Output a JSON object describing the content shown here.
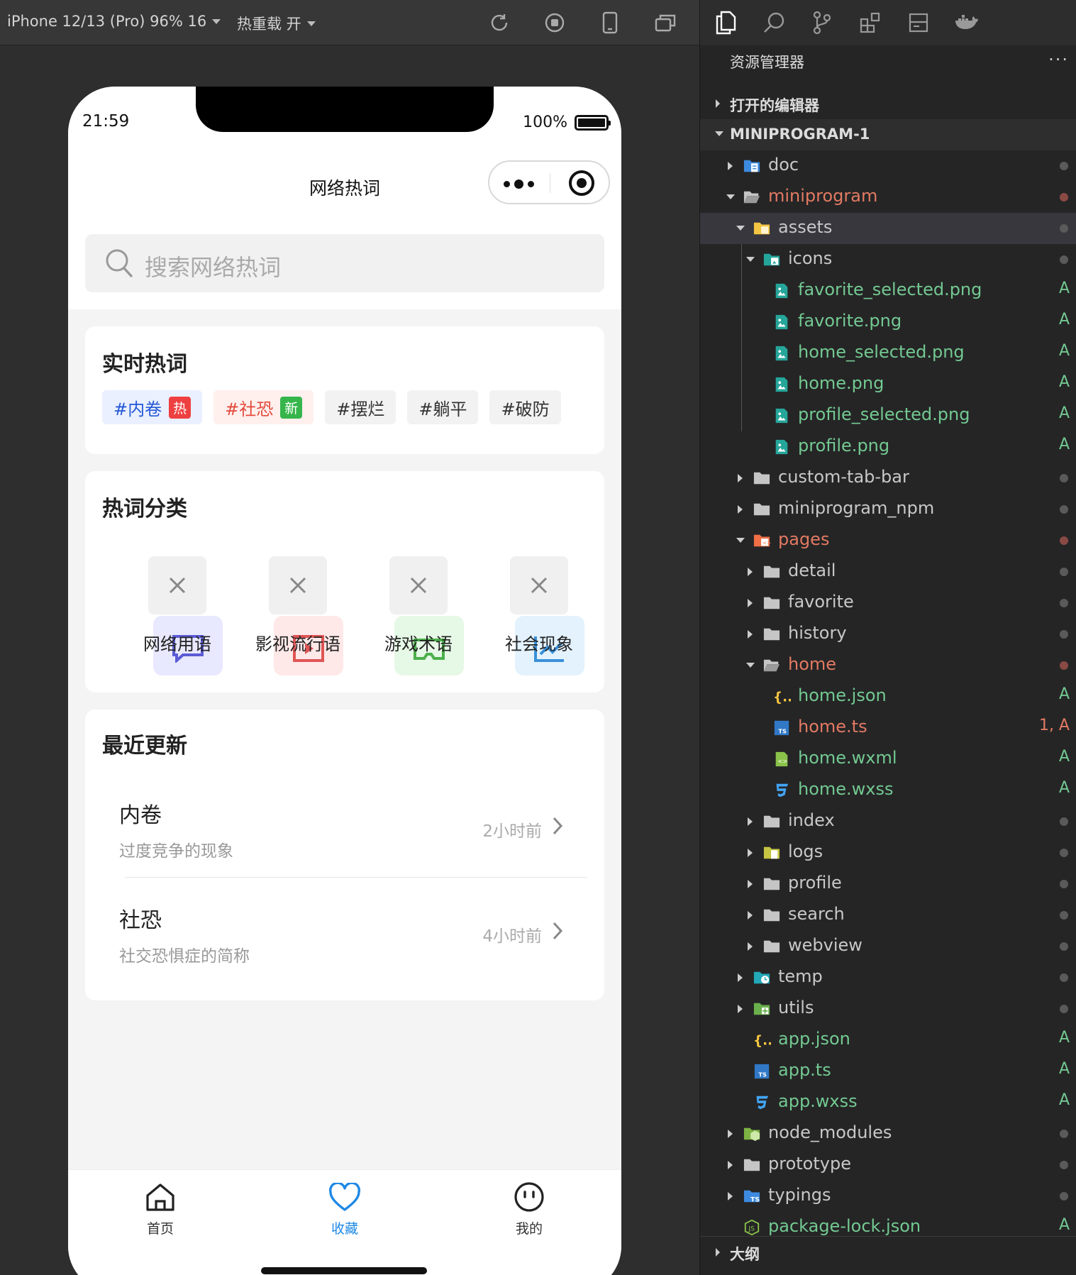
{
  "toolbar": {
    "device": "iPhone 12/13 (Pro) 96% 16",
    "reload": "热重载 开"
  },
  "status": {
    "time": "21:59",
    "battery": "100%"
  },
  "page": {
    "title": "网络热词"
  },
  "search": {
    "placeholder": "搜索网络热词"
  },
  "realtime": {
    "title": "实时热词",
    "tags": [
      {
        "text": "#内卷",
        "badge": "热"
      },
      {
        "text": "#社恐",
        "badge": "新"
      },
      {
        "text": "#摆烂"
      },
      {
        "text": "#躺平"
      },
      {
        "text": "#破防"
      }
    ]
  },
  "categories": {
    "title": "热词分类",
    "items": [
      {
        "label": "网络用语",
        "color": "#5b5bd6",
        "bg": "#e8e8ff"
      },
      {
        "label": "影视流行语",
        "color": "#e05555",
        "bg": "#ffe8e8"
      },
      {
        "label": "游戏术语",
        "color": "#4cb04c",
        "bg": "#e6f8e6"
      },
      {
        "label": "社会现象",
        "color": "#3a90d9",
        "bg": "#e3f2fd"
      }
    ]
  },
  "recent": {
    "title": "最近更新",
    "items": [
      {
        "word": "内卷",
        "desc": "过度竞争的现象",
        "time": "2小时前"
      },
      {
        "word": "社恐",
        "desc": "社交恐惧症的简称",
        "time": "4小时前"
      }
    ]
  },
  "tabbar": [
    {
      "label": "首页",
      "icon": "home-icon"
    },
    {
      "label": "收藏",
      "icon": "heart-icon",
      "active": true
    },
    {
      "label": "我的",
      "icon": "smile-icon"
    }
  ],
  "explorer": {
    "header": "资源管理器",
    "more": "···",
    "open_editors": "打开的编辑器",
    "project": "MINIPROGRAM-1",
    "outline": "大纲",
    "tree": [
      {
        "name": "doc",
        "kind": "folder-doc",
        "depth": 0,
        "open": false
      },
      {
        "name": "miniprogram",
        "kind": "folder",
        "depth": 0,
        "open": true,
        "modified": true
      },
      {
        "name": "assets",
        "kind": "folder-assets",
        "depth": 1,
        "open": true,
        "selected": true
      },
      {
        "name": "icons",
        "kind": "folder-icons",
        "depth": 2,
        "open": true
      },
      {
        "name": "favorite_selected.png",
        "kind": "image",
        "depth": 3,
        "status": "A"
      },
      {
        "name": "favorite.png",
        "kind": "image",
        "depth": 3,
        "status": "A"
      },
      {
        "name": "home_selected.png",
        "kind": "image",
        "depth": 3,
        "status": "A"
      },
      {
        "name": "home.png",
        "kind": "image",
        "depth": 3,
        "status": "A"
      },
      {
        "name": "profile_selected.png",
        "kind": "image",
        "depth": 3,
        "status": "A"
      },
      {
        "name": "profile.png",
        "kind": "image",
        "depth": 3,
        "status": "A"
      },
      {
        "name": "custom-tab-bar",
        "kind": "folder",
        "depth": 1,
        "open": false
      },
      {
        "name": "miniprogram_npm",
        "kind": "folder",
        "depth": 1,
        "open": false
      },
      {
        "name": "pages",
        "kind": "folder-pages",
        "depth": 1,
        "open": true,
        "modified": true
      },
      {
        "name": "detail",
        "kind": "folder",
        "depth": 2,
        "open": false
      },
      {
        "name": "favorite",
        "kind": "folder",
        "depth": 2,
        "open": false
      },
      {
        "name": "history",
        "kind": "folder",
        "depth": 2,
        "open": false
      },
      {
        "name": "home",
        "kind": "folder",
        "depth": 2,
        "open": true,
        "modified": true
      },
      {
        "name": "home.json",
        "kind": "json",
        "depth": 3,
        "status": "A"
      },
      {
        "name": "home.ts",
        "kind": "ts",
        "depth": 3,
        "status": "1, A",
        "error": true
      },
      {
        "name": "home.wxml",
        "kind": "wxml",
        "depth": 3,
        "status": "A"
      },
      {
        "name": "home.wxss",
        "kind": "css",
        "depth": 3,
        "status": "A"
      },
      {
        "name": "index",
        "kind": "folder",
        "depth": 2,
        "open": false
      },
      {
        "name": "logs",
        "kind": "folder-logs",
        "depth": 2,
        "open": false
      },
      {
        "name": "profile",
        "kind": "folder",
        "depth": 2,
        "open": false
      },
      {
        "name": "search",
        "kind": "folder",
        "depth": 2,
        "open": false
      },
      {
        "name": "webview",
        "kind": "folder",
        "depth": 2,
        "open": false
      },
      {
        "name": "temp",
        "kind": "folder-temp",
        "depth": 1,
        "open": false
      },
      {
        "name": "utils",
        "kind": "folder-utils",
        "depth": 1,
        "open": false
      },
      {
        "name": "app.json",
        "kind": "json",
        "depth": 1,
        "status": "A"
      },
      {
        "name": "app.ts",
        "kind": "ts",
        "depth": 1,
        "status": "A"
      },
      {
        "name": "app.wxss",
        "kind": "css",
        "depth": 1,
        "status": "A"
      },
      {
        "name": "node_modules",
        "kind": "folder-node",
        "depth": 0,
        "open": false
      },
      {
        "name": "prototype",
        "kind": "folder",
        "depth": 0,
        "open": false
      },
      {
        "name": "typings",
        "kind": "folder-ts",
        "depth": 0,
        "open": false
      },
      {
        "name": "package-lock.json",
        "kind": "npm",
        "depth": 0,
        "status": "A"
      }
    ]
  }
}
